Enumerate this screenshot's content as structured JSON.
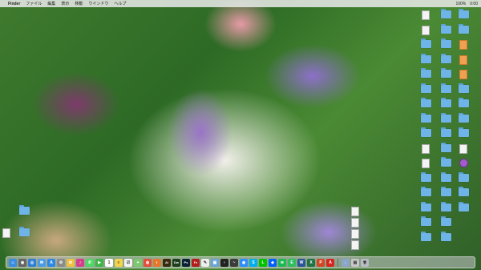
{
  "menubar": {
    "apple_icon": "apple-icon",
    "items": [
      "Finder",
      "ファイル",
      "編集",
      "表示",
      "移動",
      "ウインドウ",
      "ヘルプ"
    ],
    "status": {
      "battery": "100%",
      "clock": "0:00"
    }
  },
  "desktop": {
    "right_column_1": [
      {
        "label": "",
        "kind": "file"
      },
      {
        "label": "",
        "kind": "file"
      },
      {
        "label": "",
        "kind": "folder"
      },
      {
        "label": "",
        "kind": "folder"
      },
      {
        "label": "",
        "kind": "folder"
      },
      {
        "label": "",
        "kind": "folder"
      },
      {
        "label": "",
        "kind": "folder"
      },
      {
        "label": "",
        "kind": "folder"
      },
      {
        "label": "",
        "kind": "folder"
      },
      {
        "label": "",
        "kind": "file"
      },
      {
        "label": "",
        "kind": "file"
      },
      {
        "label": "",
        "kind": "folder"
      },
      {
        "label": "",
        "kind": "folder"
      },
      {
        "label": "",
        "kind": "folder"
      },
      {
        "label": "",
        "kind": "folder"
      },
      {
        "label": "",
        "kind": "folder"
      }
    ],
    "right_column_2": [
      {
        "label": "",
        "kind": "folder"
      },
      {
        "label": "",
        "kind": "folder"
      },
      {
        "label": "",
        "kind": "folder"
      },
      {
        "label": "",
        "kind": "folder"
      },
      {
        "label": "",
        "kind": "folder"
      },
      {
        "label": "",
        "kind": "folder"
      },
      {
        "label": "",
        "kind": "folder"
      },
      {
        "label": "",
        "kind": "folder"
      },
      {
        "label": "",
        "kind": "folder"
      },
      {
        "label": "",
        "kind": "folder"
      },
      {
        "label": "",
        "kind": "folder"
      },
      {
        "label": "",
        "kind": "folder"
      },
      {
        "label": "",
        "kind": "folder"
      },
      {
        "label": "",
        "kind": "folder"
      },
      {
        "label": "",
        "kind": "folder"
      },
      {
        "label": "",
        "kind": "folder"
      }
    ],
    "right_column_3": [
      {
        "label": "",
        "kind": "folder"
      },
      {
        "label": "",
        "kind": "folder"
      },
      {
        "label": "",
        "kind": "file-orange"
      },
      {
        "label": "",
        "kind": "file-orange"
      },
      {
        "label": "",
        "kind": "file-orange"
      },
      {
        "label": "",
        "kind": "folder"
      },
      {
        "label": "",
        "kind": "folder"
      },
      {
        "label": "",
        "kind": "folder"
      },
      {
        "label": "",
        "kind": "folder"
      },
      {
        "label": "",
        "kind": "file"
      },
      {
        "label": "",
        "kind": "file-purple"
      },
      {
        "label": "",
        "kind": "folder"
      },
      {
        "label": "",
        "kind": "folder"
      },
      {
        "label": "",
        "kind": "folder"
      }
    ],
    "mid_column": [
      {
        "label": "",
        "kind": "file"
      },
      {
        "label": "",
        "kind": "file"
      },
      {
        "label": "",
        "kind": "file"
      },
      {
        "label": "",
        "kind": "file"
      }
    ],
    "left_icons": [
      {
        "label": "",
        "kind": "folder"
      },
      {
        "label": "",
        "kind": "file"
      },
      {
        "label": "",
        "kind": "folder"
      }
    ]
  },
  "dock": {
    "apps": [
      {
        "name": "finder-icon",
        "color": "#3a8de0",
        "glyph": "☺"
      },
      {
        "name": "launchpad-icon",
        "color": "#666666",
        "glyph": "◉"
      },
      {
        "name": "safari-icon",
        "color": "#2f7fd8",
        "glyph": "◎"
      },
      {
        "name": "mail-icon",
        "color": "#4a9be8",
        "glyph": "✉"
      },
      {
        "name": "app-store-icon",
        "color": "#2d89e6",
        "glyph": "A"
      },
      {
        "name": "system-preferences-icon",
        "color": "#8a8a8a",
        "glyph": "⚙"
      },
      {
        "name": "photos-icon",
        "color": "#f0c040",
        "glyph": "✿"
      },
      {
        "name": "itunes-icon",
        "color": "#d43f8d",
        "glyph": "♪"
      },
      {
        "name": "messages-icon",
        "color": "#4cd964",
        "glyph": "✆"
      },
      {
        "name": "facetime-icon",
        "color": "#3fb54a",
        "glyph": "▶"
      },
      {
        "name": "calendar-icon",
        "color": "#ffffff",
        "glyph": "1"
      },
      {
        "name": "notes-icon",
        "color": "#f5d44b",
        "glyph": "≡"
      },
      {
        "name": "reminders-icon",
        "color": "#f4f4f4",
        "glyph": "☑"
      },
      {
        "name": "maps-icon",
        "color": "#7ec870",
        "glyph": "⌖"
      },
      {
        "name": "chrome-icon",
        "color": "#e44d3a",
        "glyph": "◍"
      },
      {
        "name": "firefox-icon",
        "color": "#e8772e",
        "glyph": "◐"
      },
      {
        "name": "illustrator-icon",
        "color": "#3b2a0f",
        "glyph": "Ai"
      },
      {
        "name": "dreamweaver-icon",
        "color": "#1f3d1f",
        "glyph": "Dw"
      },
      {
        "name": "photoshop-icon",
        "color": "#0b2236",
        "glyph": "Ps"
      },
      {
        "name": "filezilla-icon",
        "color": "#b21e1e",
        "glyph": "Fz"
      },
      {
        "name": "textedit-icon",
        "color": "#eeeeee",
        "glyph": "✎"
      },
      {
        "name": "preview-icon",
        "color": "#6aa4d8",
        "glyph": "▣"
      },
      {
        "name": "terminal-icon",
        "color": "#222222",
        "glyph": "›"
      },
      {
        "name": "activity-monitor-icon",
        "color": "#3c3c3c",
        "glyph": "~"
      },
      {
        "name": "zoom-icon",
        "color": "#2d8cff",
        "glyph": "◉"
      },
      {
        "name": "skype-icon",
        "color": "#00aff0",
        "glyph": "S"
      },
      {
        "name": "line-icon",
        "color": "#00c300",
        "glyph": "L"
      },
      {
        "name": "dropbox-icon",
        "color": "#0061fe",
        "glyph": "◆"
      },
      {
        "name": "spotify-icon",
        "color": "#1db954",
        "glyph": "≋"
      },
      {
        "name": "evernote-icon",
        "color": "#2dbe60",
        "glyph": "E"
      },
      {
        "name": "word-icon",
        "color": "#2b579a",
        "glyph": "W"
      },
      {
        "name": "excel-icon",
        "color": "#217346",
        "glyph": "X"
      },
      {
        "name": "powerpoint-icon",
        "color": "#d24726",
        "glyph": "P"
      },
      {
        "name": "acrobat-icon",
        "color": "#d7261e",
        "glyph": "A"
      }
    ],
    "trailing": [
      {
        "name": "downloads-stack-icon",
        "color": "#8aa6c8",
        "glyph": "↓"
      },
      {
        "name": "documents-stack-icon",
        "color": "#c8c8c8",
        "glyph": "▤"
      },
      {
        "name": "trash-icon",
        "color": "#b8bcc4",
        "glyph": "🗑"
      }
    ]
  }
}
